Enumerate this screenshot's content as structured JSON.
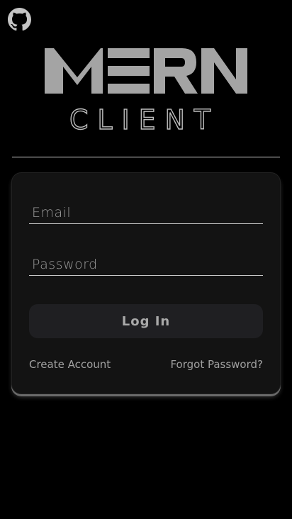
{
  "header": {
    "github_icon": "github-icon"
  },
  "logo": {
    "top_word": "MERN",
    "bottom_word": "CLIENT"
  },
  "login_form": {
    "email_placeholder": "Email",
    "email_value": "",
    "password_placeholder": "Password",
    "password_value": "",
    "submit_label": "Log In",
    "create_account_label": "Create Account",
    "forgot_password_label": "Forgot Password?"
  },
  "colors": {
    "background": "#000000",
    "card": "#131313",
    "logo_gray": "#a4a4a4",
    "text_muted": "#a0a0a0"
  }
}
